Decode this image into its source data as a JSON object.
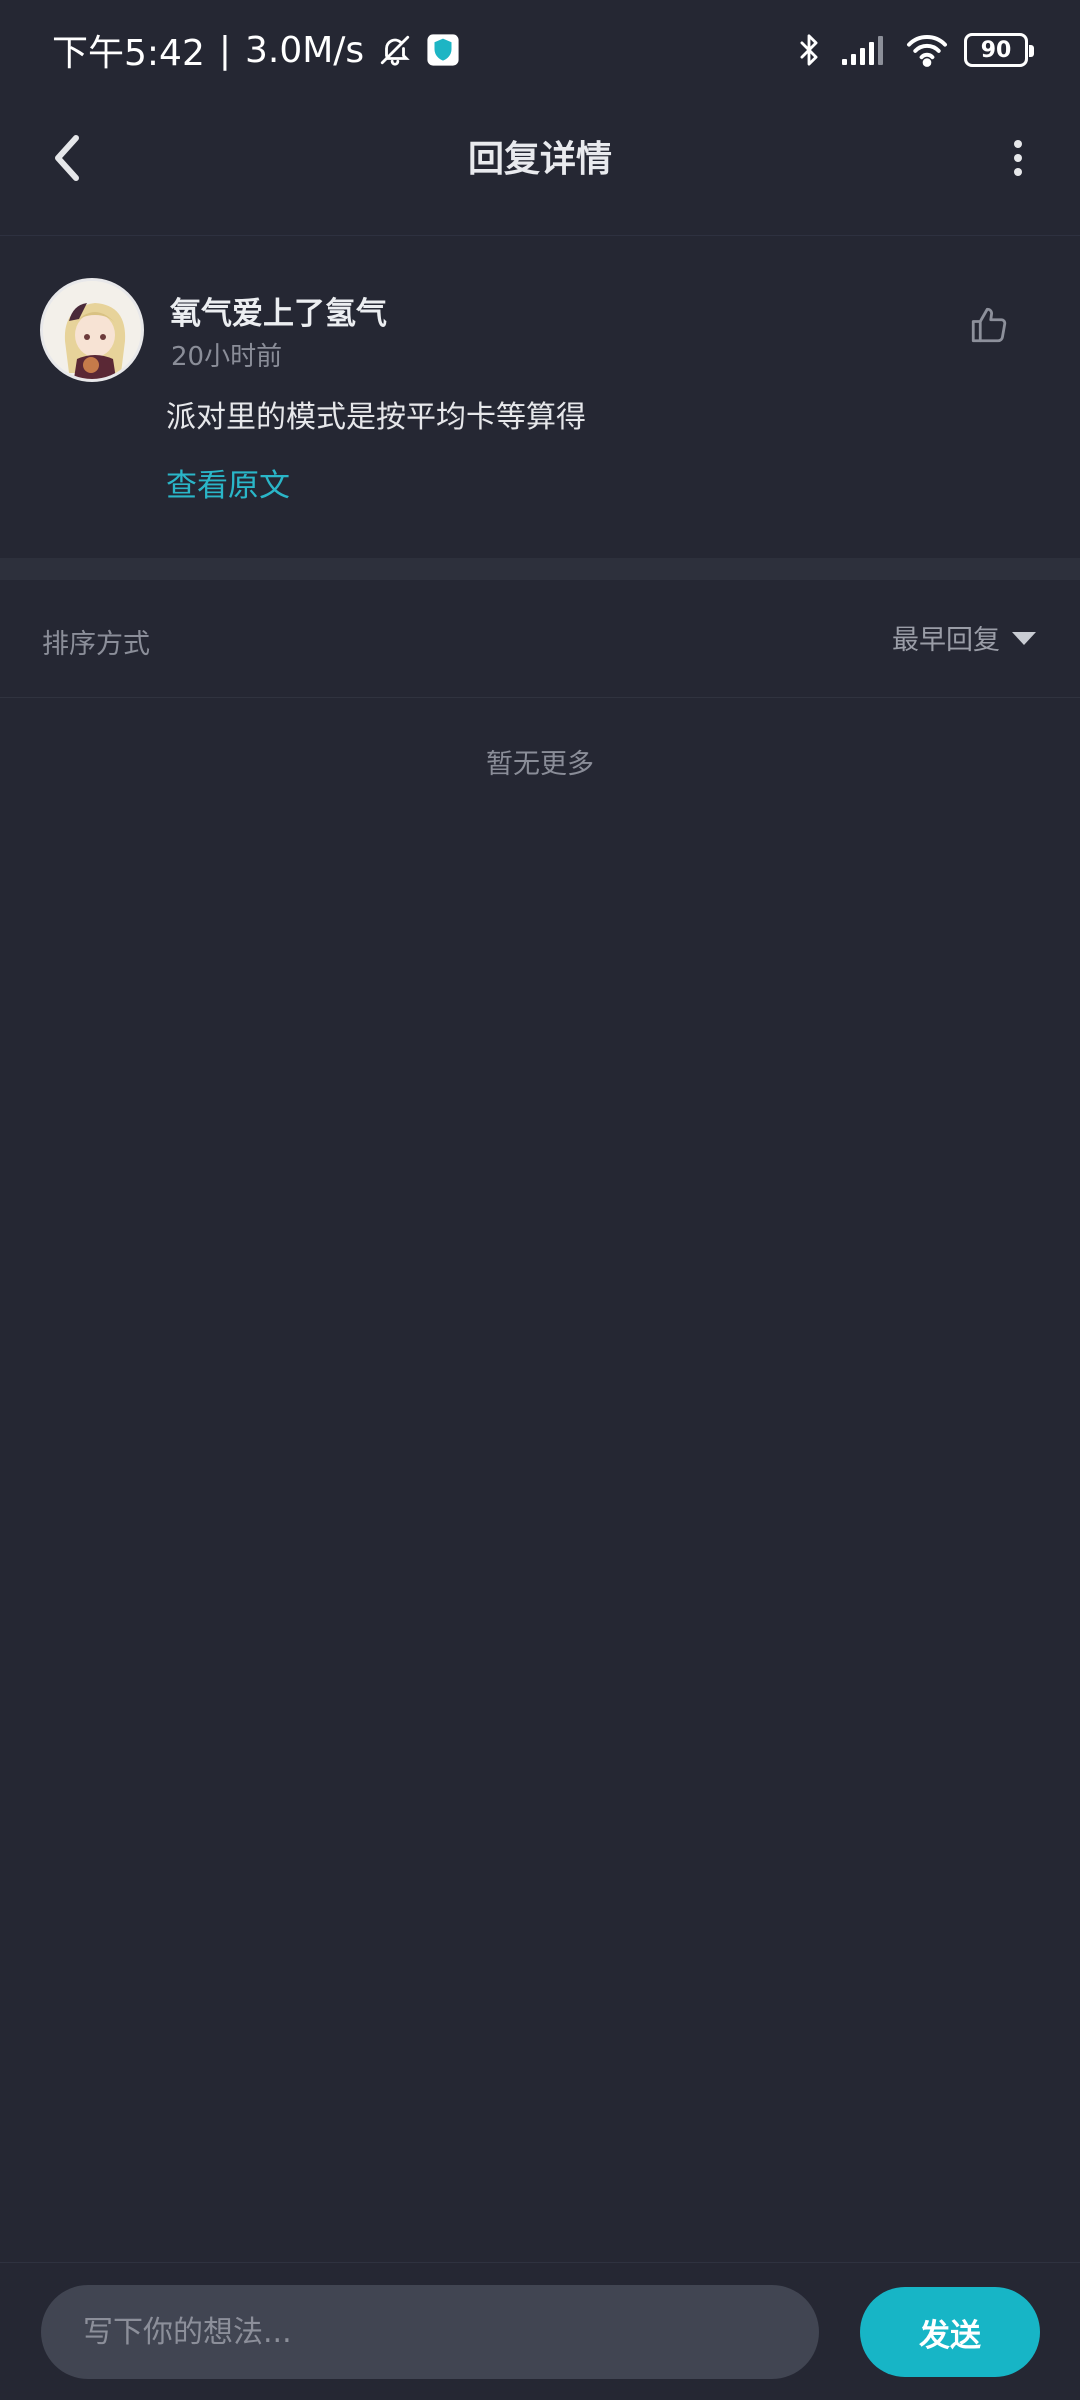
{
  "status_bar": {
    "time": "下午5:42",
    "separator": "|",
    "speed": "3.0M/s",
    "battery": "90",
    "icons": [
      "mute-bell-icon",
      "shield-app-icon",
      "bluetooth-icon",
      "signal-icon",
      "wifi-icon",
      "battery-icon"
    ]
  },
  "header": {
    "title": "回复详情",
    "back_icon": "chevron-left-icon",
    "more_icon": "more-vertical-icon"
  },
  "comment": {
    "username": "氧气爱上了氢气",
    "time_ago": "20小时前",
    "text": "派对里的模式是按平均卡等算得",
    "view_original": "查看原文",
    "like_icon": "thumbs-up-icon"
  },
  "sort": {
    "label": "排序方式",
    "selected": "最早回复"
  },
  "empty_note": "暂无更多",
  "composer": {
    "placeholder": "写下你的想法...",
    "send_label": "发送"
  },
  "colors": {
    "background": "#252733",
    "accent": "#17b5c6",
    "link": "#2ab6c8",
    "input_bg": "#414552"
  }
}
